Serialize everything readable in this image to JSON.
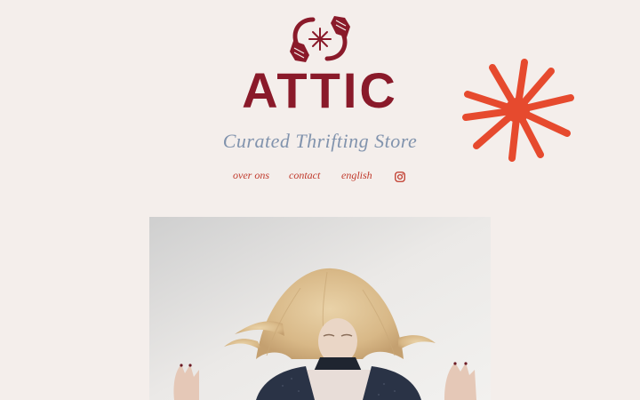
{
  "brand": {
    "name": "ATTIC",
    "tagline": "Curated Thrifting Store",
    "logo_icon": "hands-star-logo",
    "primary_color": "#8a1a2a",
    "accent_color": "#e64a2e",
    "tagline_color": "#8193ad"
  },
  "nav": {
    "items": [
      {
        "label": "over ons"
      },
      {
        "label": "contact"
      },
      {
        "label": "english"
      }
    ],
    "instagram_icon": "instagram-icon"
  },
  "hero": {
    "image_subject": "photo-woman-tossing-blonde-hair"
  },
  "decor": {
    "starburst_icon": "starburst-icon"
  }
}
